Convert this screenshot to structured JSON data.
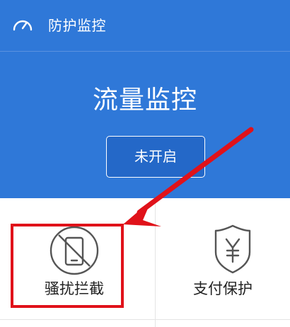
{
  "header": {
    "title": "防护监控",
    "icon": "speedometer-icon"
  },
  "hero": {
    "title": "流量监控",
    "button_label": "未开启"
  },
  "tiles": [
    {
      "label": "骚扰拦截",
      "icon": "no-phone-icon"
    },
    {
      "label": "支付保护",
      "icon": "yen-shield-icon"
    }
  ],
  "colors": {
    "header_bg": "#2f78d8",
    "button_bg": "#2468c8",
    "highlight": "#e0121a",
    "text_dark": "#222222"
  }
}
